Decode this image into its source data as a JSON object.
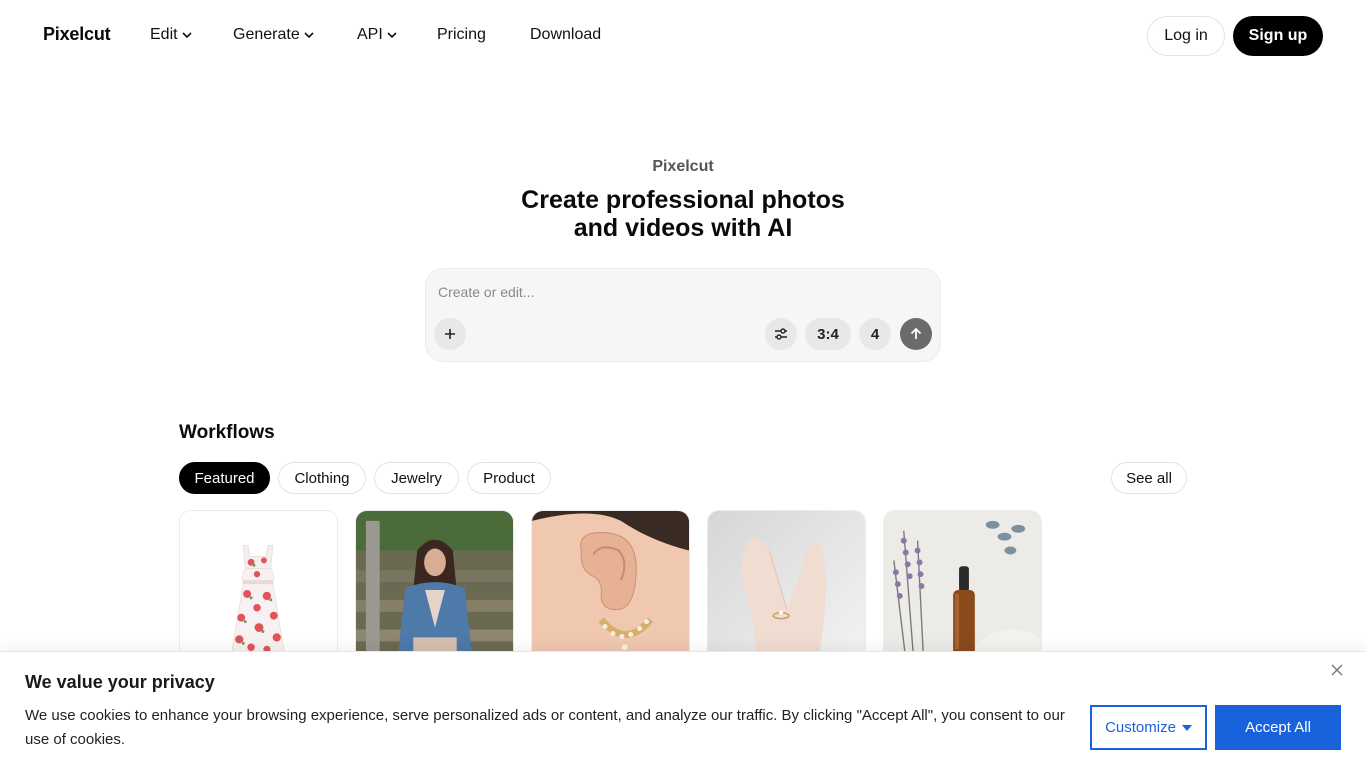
{
  "nav": {
    "logo": "Pixelcut",
    "items": [
      {
        "label": "Edit",
        "has_dropdown": true
      },
      {
        "label": "Generate",
        "has_dropdown": true
      },
      {
        "label": "API",
        "has_dropdown": true
      },
      {
        "label": "Pricing",
        "has_dropdown": false
      },
      {
        "label": "Download",
        "has_dropdown": false
      }
    ],
    "login_label": "Log in",
    "signup_label": "Sign up"
  },
  "hero": {
    "eyebrow": "Pixelcut",
    "title_line1": "Create professional photos",
    "title_line2": "and videos with AI",
    "prompt": {
      "placeholder": "Create or edit...",
      "value": "",
      "add_icon": "plus-icon",
      "settings_icon": "sliders-icon",
      "aspect_ratio": "3:4",
      "count": "4",
      "send_icon": "arrow-up-icon"
    }
  },
  "workflows": {
    "title": "Workflows",
    "tabs": [
      {
        "label": "Featured",
        "active": true
      },
      {
        "label": "Clothing",
        "active": false
      },
      {
        "label": "Jewelry",
        "active": false
      },
      {
        "label": "Product",
        "active": false
      }
    ],
    "see_all_label": "See all",
    "cards": [
      {
        "subject": "floral-dress-image"
      },
      {
        "subject": "denim-jacket-model-image"
      },
      {
        "subject": "earring-on-ear-image"
      },
      {
        "subject": "ring-on-hand-image"
      },
      {
        "subject": "serum-bottle-lavender-image"
      }
    ]
  },
  "cookie_banner": {
    "title": "We value your privacy",
    "text": "We use cookies to enhance your browsing experience, serve personalized ads or content, and analyze our traffic. By clicking \"Accept All\", you consent to our use of cookies.",
    "customize_label": "Customize",
    "accept_label": "Accept All",
    "accent_color": "#1863dc"
  }
}
